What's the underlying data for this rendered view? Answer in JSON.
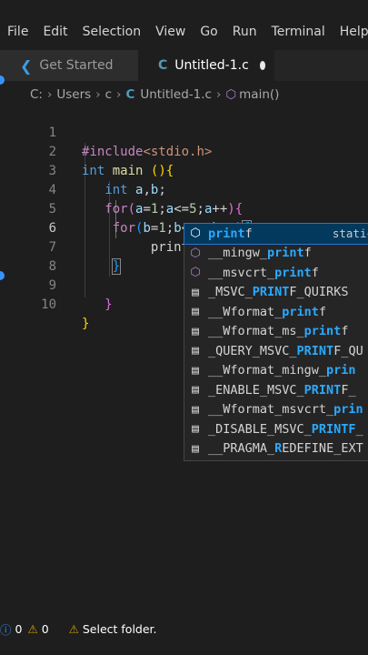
{
  "menu": [
    "File",
    "Edit",
    "Selection",
    "View",
    "Go",
    "Run",
    "Terminal",
    "Help"
  ],
  "tabs": [
    {
      "label": "Get Started",
      "icon": "vscode-icon"
    },
    {
      "label": "Untitled-1.c",
      "icon": "c-file-icon",
      "modified": true
    }
  ],
  "breadcrumb": {
    "drive": "C:",
    "folder1": "Users",
    "folder2": "c",
    "file_icon": "C",
    "file": "Untitled-1.c",
    "symbol": "main()"
  },
  "editor": {
    "line_numbers": [
      "1",
      "2",
      "3",
      "4",
      "5",
      "6",
      "7",
      "8",
      "9",
      "10"
    ],
    "current_line": 6
  },
  "suggest": {
    "items": [
      {
        "prefix": "",
        "match": "print",
        "suffix": "f",
        "detail": "static",
        "kind": "method"
      },
      {
        "prefix": "__mingw_",
        "match": "print",
        "suffix": "f",
        "kind": "method"
      },
      {
        "prefix": "__msvcrt_",
        "match": "print",
        "suffix": "f",
        "kind": "method"
      },
      {
        "prefix": "_MSVC_",
        "match": "PRINT",
        "suffix": "F_QUIRKS",
        "kind": "field"
      },
      {
        "prefix": "__Wformat_",
        "match": "print",
        "suffix": "f",
        "kind": "field"
      },
      {
        "prefix": "__Wformat_ms_",
        "match": "print",
        "suffix": "f",
        "kind": "field"
      },
      {
        "prefix": "_QUERY_MSVC_",
        "match": "PRINT",
        "suffix": "F_QU",
        "kind": "field"
      },
      {
        "prefix": "__Wformat_mingw_",
        "match": "prin",
        "suffix": "",
        "kind": "field"
      },
      {
        "prefix": "_ENABLE_MSVC_",
        "match": "PRINT",
        "suffix": "F_",
        "kind": "field"
      },
      {
        "prefix": "__Wformat_msvcrt_",
        "match": "prin",
        "suffix": "",
        "kind": "field"
      },
      {
        "prefix": "_DISABLE_MSVC_",
        "match": "PRINTF",
        "suffix": "_",
        "kind": "field"
      },
      {
        "prefix": "__PRAGMA_",
        "match": "R",
        "suffix": "EDEFINE_EXT",
        "kind": "field"
      }
    ]
  },
  "status": {
    "errors": "0",
    "warnings": "0",
    "message": "Select folder."
  }
}
